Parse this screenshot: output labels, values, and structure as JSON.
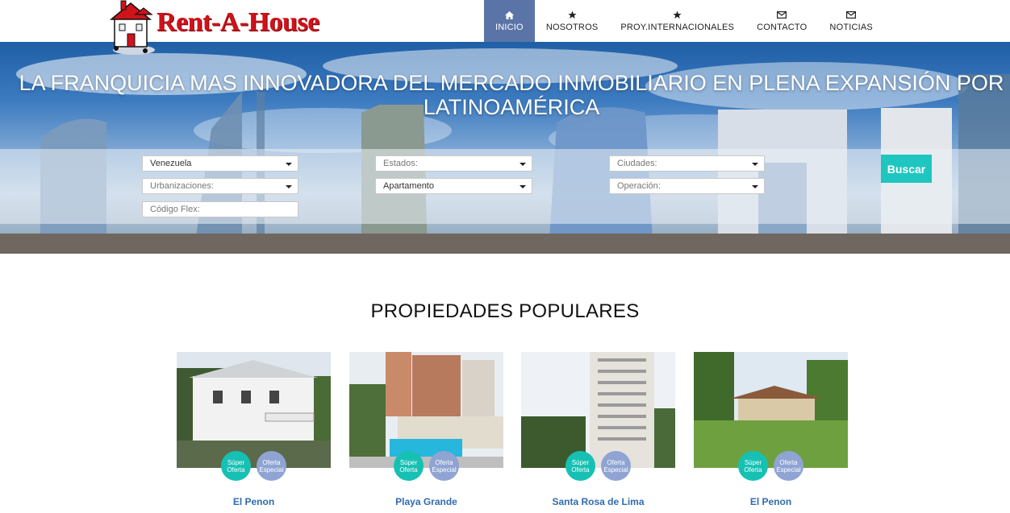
{
  "brand": {
    "name": "Rent-A-House"
  },
  "nav": {
    "items": [
      {
        "label": "INICIO",
        "icon": "home-icon",
        "active": true
      },
      {
        "label": "NOSOTROS",
        "icon": "star-icon",
        "active": false
      },
      {
        "label": "PROY.INTERNACIONALES",
        "icon": "star-icon",
        "active": false
      },
      {
        "label": "CONTACTO",
        "icon": "envelope-icon",
        "active": false
      },
      {
        "label": "NOTICIAS",
        "icon": "envelope-icon",
        "active": false
      }
    ]
  },
  "hero": {
    "title_line1": "LA FRANQUICIA MAS INNOVADORA DEL MERCADO INMOBILIARIO EN PLENA EXPANSIÓN POR",
    "title_line2": "LATINOAMÉRICA"
  },
  "search": {
    "pais": {
      "value": "Venezuela"
    },
    "estados": {
      "placeholder": "Estados:"
    },
    "ciudades": {
      "placeholder": "Ciudades:"
    },
    "urbanizaciones": {
      "placeholder": "Urbanizaciones:"
    },
    "tipo": {
      "value": "Apartamento"
    },
    "operacion": {
      "placeholder": "Operación:"
    },
    "codigo": {
      "placeholder": "Código Flex:"
    },
    "button_label": "Buscar"
  },
  "popular": {
    "title": "PROPIEDADES POPULARES",
    "badge_super": "Súper Oferta",
    "badge_especial": "Oferta Especial",
    "cards": [
      {
        "name": "El Penon"
      },
      {
        "name": "Playa Grande"
      },
      {
        "name": "Santa Rosa de Lima"
      },
      {
        "name": "El Penon"
      }
    ]
  },
  "colors": {
    "nav_active": "#5b74a8",
    "accent": "#1fc6c0",
    "badge_super": "#16c1b4",
    "badge_especial": "#8fa4d3",
    "brand_red": "#d0121a",
    "link_blue": "#2f6bb0"
  }
}
